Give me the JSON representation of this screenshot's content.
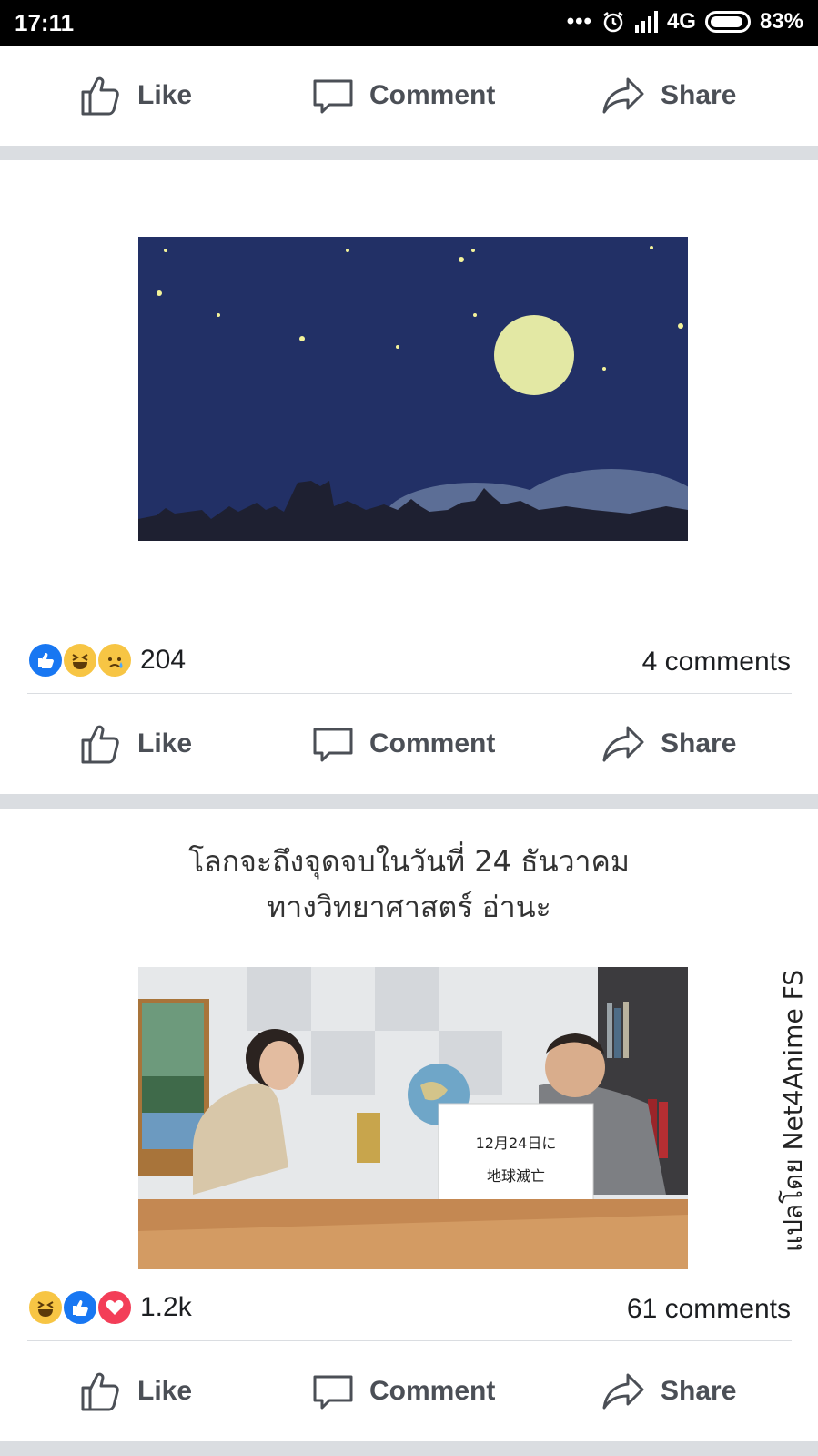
{
  "status_bar": {
    "time": "17:11",
    "network": "4G",
    "battery": "83%"
  },
  "actions": {
    "like": "Like",
    "comment": "Comment",
    "share": "Share"
  },
  "posts": [
    {
      "reaction_icons": [
        "like-icon",
        "haha-icon",
        "sad-icon"
      ],
      "reaction_count": "204",
      "comment_count": "4 comments"
    },
    {
      "caption_line1": "โลกจะถึงจุดจบในวันที่ 24 ธันวาคม",
      "caption_line2": "ทางวิทยาศาสตร์ อ่านะ",
      "sign_line1": "12月24日に",
      "sign_line2": "地球滅亡",
      "watermark": "แปลโดย Net4Anime FS",
      "reaction_icons": [
        "haha-icon",
        "like-icon",
        "love-icon"
      ],
      "reaction_count": "1.2k",
      "comment_count": "61 comments"
    }
  ],
  "colors": {
    "action_text": "#4b4f56",
    "separator": "#dadde1",
    "night_sky": "#223066",
    "moon": "#e3e8a4",
    "like_blue": "#1877f2"
  }
}
